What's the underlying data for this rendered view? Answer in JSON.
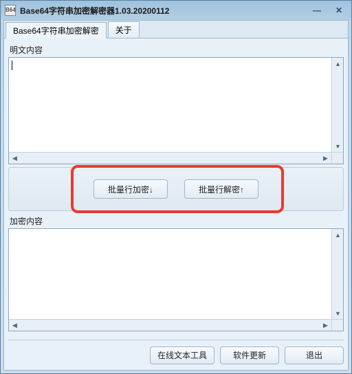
{
  "window": {
    "title": "Base64字符串加密解密器1.03.20200112",
    "icon_label": "B64"
  },
  "tabs": {
    "main": "Base64字符串加密解密",
    "about": "关于"
  },
  "sections": {
    "plaintext_label": "明文内容",
    "ciphertext_label": "加密内容"
  },
  "plaintext_value": "",
  "ciphertext_value": "",
  "buttons": {
    "batch_encrypt": "批量行加密↓",
    "batch_decrypt": "批量行解密↑",
    "online_tool": "在线文本工具",
    "update": "软件更新",
    "exit": "退出"
  },
  "scroll_glyphs": {
    "up": "▲",
    "down": "▼",
    "left": "◀",
    "right": "▶"
  }
}
